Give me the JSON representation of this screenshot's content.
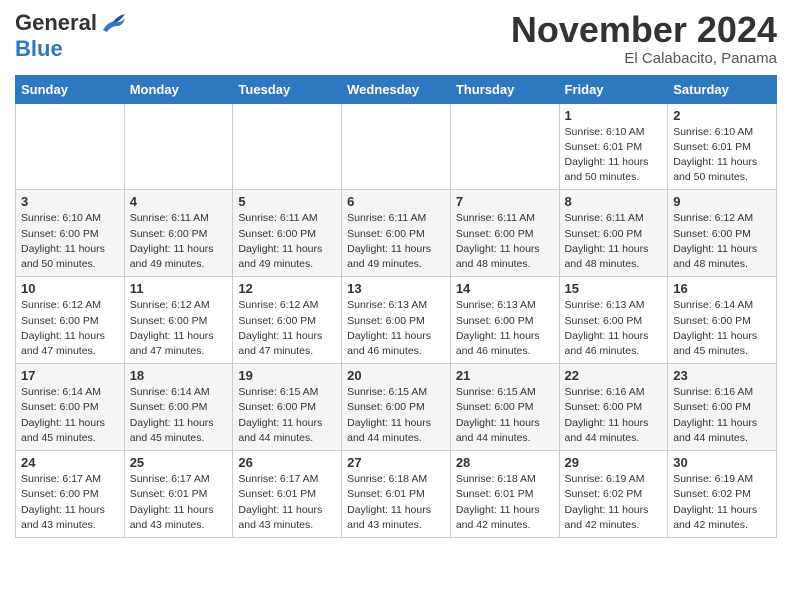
{
  "logo": {
    "general": "General",
    "blue": "Blue"
  },
  "title": "November 2024",
  "location": "El Calabacito, Panama",
  "days_of_week": [
    "Sunday",
    "Monday",
    "Tuesday",
    "Wednesday",
    "Thursday",
    "Friday",
    "Saturday"
  ],
  "weeks": [
    [
      {
        "day": "",
        "info": ""
      },
      {
        "day": "",
        "info": ""
      },
      {
        "day": "",
        "info": ""
      },
      {
        "day": "",
        "info": ""
      },
      {
        "day": "",
        "info": ""
      },
      {
        "day": "1",
        "info": "Sunrise: 6:10 AM\nSunset: 6:01 PM\nDaylight: 11 hours and 50 minutes."
      },
      {
        "day": "2",
        "info": "Sunrise: 6:10 AM\nSunset: 6:01 PM\nDaylight: 11 hours and 50 minutes."
      }
    ],
    [
      {
        "day": "3",
        "info": "Sunrise: 6:10 AM\nSunset: 6:00 PM\nDaylight: 11 hours and 50 minutes."
      },
      {
        "day": "4",
        "info": "Sunrise: 6:11 AM\nSunset: 6:00 PM\nDaylight: 11 hours and 49 minutes."
      },
      {
        "day": "5",
        "info": "Sunrise: 6:11 AM\nSunset: 6:00 PM\nDaylight: 11 hours and 49 minutes."
      },
      {
        "day": "6",
        "info": "Sunrise: 6:11 AM\nSunset: 6:00 PM\nDaylight: 11 hours and 49 minutes."
      },
      {
        "day": "7",
        "info": "Sunrise: 6:11 AM\nSunset: 6:00 PM\nDaylight: 11 hours and 48 minutes."
      },
      {
        "day": "8",
        "info": "Sunrise: 6:11 AM\nSunset: 6:00 PM\nDaylight: 11 hours and 48 minutes."
      },
      {
        "day": "9",
        "info": "Sunrise: 6:12 AM\nSunset: 6:00 PM\nDaylight: 11 hours and 48 minutes."
      }
    ],
    [
      {
        "day": "10",
        "info": "Sunrise: 6:12 AM\nSunset: 6:00 PM\nDaylight: 11 hours and 47 minutes."
      },
      {
        "day": "11",
        "info": "Sunrise: 6:12 AM\nSunset: 6:00 PM\nDaylight: 11 hours and 47 minutes."
      },
      {
        "day": "12",
        "info": "Sunrise: 6:12 AM\nSunset: 6:00 PM\nDaylight: 11 hours and 47 minutes."
      },
      {
        "day": "13",
        "info": "Sunrise: 6:13 AM\nSunset: 6:00 PM\nDaylight: 11 hours and 46 minutes."
      },
      {
        "day": "14",
        "info": "Sunrise: 6:13 AM\nSunset: 6:00 PM\nDaylight: 11 hours and 46 minutes."
      },
      {
        "day": "15",
        "info": "Sunrise: 6:13 AM\nSunset: 6:00 PM\nDaylight: 11 hours and 46 minutes."
      },
      {
        "day": "16",
        "info": "Sunrise: 6:14 AM\nSunset: 6:00 PM\nDaylight: 11 hours and 45 minutes."
      }
    ],
    [
      {
        "day": "17",
        "info": "Sunrise: 6:14 AM\nSunset: 6:00 PM\nDaylight: 11 hours and 45 minutes."
      },
      {
        "day": "18",
        "info": "Sunrise: 6:14 AM\nSunset: 6:00 PM\nDaylight: 11 hours and 45 minutes."
      },
      {
        "day": "19",
        "info": "Sunrise: 6:15 AM\nSunset: 6:00 PM\nDaylight: 11 hours and 44 minutes."
      },
      {
        "day": "20",
        "info": "Sunrise: 6:15 AM\nSunset: 6:00 PM\nDaylight: 11 hours and 44 minutes."
      },
      {
        "day": "21",
        "info": "Sunrise: 6:15 AM\nSunset: 6:00 PM\nDaylight: 11 hours and 44 minutes."
      },
      {
        "day": "22",
        "info": "Sunrise: 6:16 AM\nSunset: 6:00 PM\nDaylight: 11 hours and 44 minutes."
      },
      {
        "day": "23",
        "info": "Sunrise: 6:16 AM\nSunset: 6:00 PM\nDaylight: 11 hours and 44 minutes."
      }
    ],
    [
      {
        "day": "24",
        "info": "Sunrise: 6:17 AM\nSunset: 6:00 PM\nDaylight: 11 hours and 43 minutes."
      },
      {
        "day": "25",
        "info": "Sunrise: 6:17 AM\nSunset: 6:01 PM\nDaylight: 11 hours and 43 minutes."
      },
      {
        "day": "26",
        "info": "Sunrise: 6:17 AM\nSunset: 6:01 PM\nDaylight: 11 hours and 43 minutes."
      },
      {
        "day": "27",
        "info": "Sunrise: 6:18 AM\nSunset: 6:01 PM\nDaylight: 11 hours and 43 minutes."
      },
      {
        "day": "28",
        "info": "Sunrise: 6:18 AM\nSunset: 6:01 PM\nDaylight: 11 hours and 42 minutes."
      },
      {
        "day": "29",
        "info": "Sunrise: 6:19 AM\nSunset: 6:02 PM\nDaylight: 11 hours and 42 minutes."
      },
      {
        "day": "30",
        "info": "Sunrise: 6:19 AM\nSunset: 6:02 PM\nDaylight: 11 hours and 42 minutes."
      }
    ]
  ]
}
